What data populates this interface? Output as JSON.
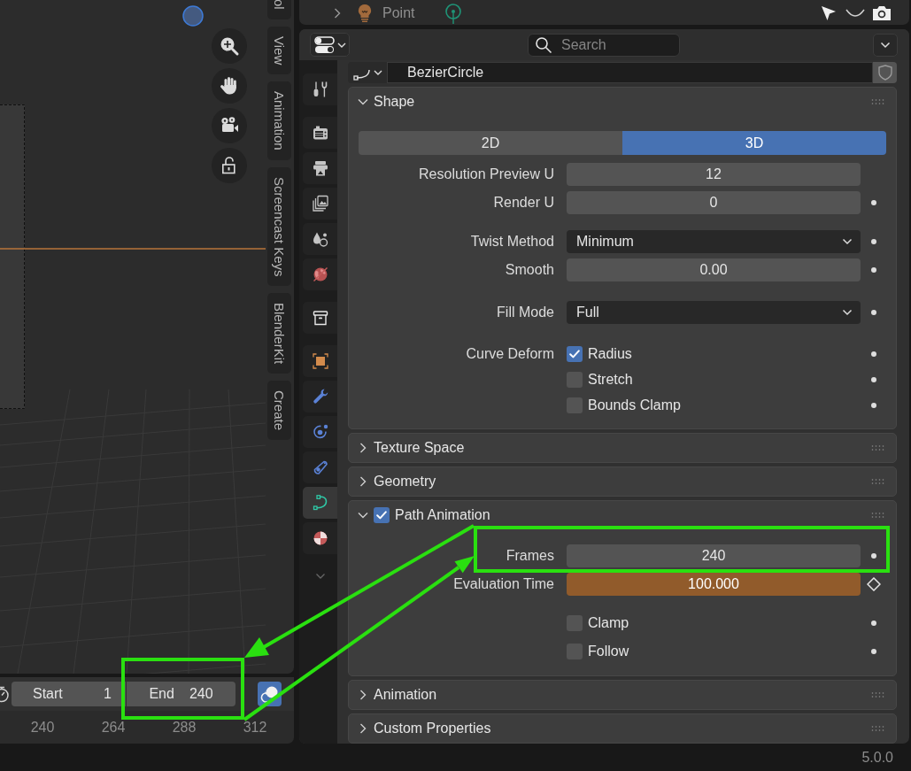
{
  "viewport": {
    "sidebar_tabs": [
      {
        "label": "ol"
      },
      {
        "label": "View"
      },
      {
        "label": "Animation"
      },
      {
        "label": "Screencast Keys"
      },
      {
        "label": "BlenderKit"
      },
      {
        "label": "Create"
      }
    ]
  },
  "timeline": {
    "start": {
      "label": "Start",
      "value": "1"
    },
    "end": {
      "label": "End",
      "value": "240"
    },
    "toggle": {
      "on": true
    },
    "frame_numbers": [
      "240",
      "264",
      "288",
      "312"
    ]
  },
  "outliner": {
    "row": {
      "label": "Point",
      "expanded": false
    }
  },
  "properties": {
    "search": {
      "placeholder": "Search"
    },
    "tab_groups": [
      [
        {
          "kind": "tool",
          "selected": false
        }
      ],
      [
        {
          "kind": "render",
          "selected": false
        },
        {
          "kind": "output",
          "selected": false
        },
        {
          "kind": "view_layer",
          "selected": false
        },
        {
          "kind": "scene",
          "selected": false
        },
        {
          "kind": "world",
          "selected": false
        }
      ],
      [
        {
          "kind": "collection",
          "selected": false
        }
      ],
      [
        {
          "kind": "object",
          "selected": false
        },
        {
          "kind": "modifiers",
          "selected": false
        },
        {
          "kind": "particles",
          "selected": false
        },
        {
          "kind": "physics",
          "selected": false
        },
        {
          "kind": "data",
          "selected": true
        },
        {
          "kind": "material",
          "selected": false
        }
      ]
    ],
    "datablock": {
      "value": "BezierCircle"
    },
    "panels": [
      {
        "title": "Shape",
        "expanded": true,
        "groups": [
          [
            {
              "kind": "segmented",
              "options": [
                {
                  "label": "2D",
                  "selected": false
                },
                {
                  "label": "3D",
                  "selected": true
                }
              ]
            },
            {
              "kind": "number",
              "label": "Resolution Preview U",
              "value": "12",
              "animated": false
            },
            {
              "kind": "number",
              "label": "Render U",
              "value": "0",
              "animated": false,
              "keyframed": false
            }
          ],
          [
            {
              "kind": "dropdown",
              "label": "Twist Method",
              "value": "Minimum",
              "keyframed": false
            },
            {
              "kind": "number",
              "label": "Smooth",
              "value": "0.00",
              "animated": false,
              "keyframed": false
            }
          ],
          [
            {
              "kind": "dropdown",
              "label": "Fill Mode",
              "value": "Full",
              "keyframed": false
            }
          ],
          [
            {
              "kind": "checkbox_column",
              "label": "Curve Deform",
              "items": [
                {
                  "text": "Radius",
                  "checked": true,
                  "keyframed": false
                },
                {
                  "text": "Stretch",
                  "checked": false,
                  "keyframed": false
                },
                {
                  "text": "Bounds Clamp",
                  "checked": false,
                  "keyframed": false
                }
              ]
            }
          ]
        ]
      },
      {
        "title": "Texture Space",
        "expanded": false
      },
      {
        "title": "Geometry",
        "expanded": false
      },
      {
        "title": "Path Animation",
        "expanded": true,
        "checked": true,
        "groups": [
          [
            {
              "kind": "number",
              "label": "Frames",
              "value": "240",
              "animated": false,
              "keyframed": false
            },
            {
              "kind": "number",
              "label": "Evaluation Time",
              "value": "100.000",
              "animated": true,
              "keyframed": true
            }
          ],
          [
            {
              "kind": "checkbox",
              "text": "Clamp",
              "checked": false,
              "keyframed": false
            },
            {
              "kind": "checkbox",
              "text": "Follow",
              "checked": false,
              "keyframed": false
            }
          ]
        ]
      },
      {
        "title": "Animation",
        "expanded": false
      },
      {
        "title": "Custom Properties",
        "expanded": false
      }
    ]
  },
  "status_bar": {
    "version": "5.0.0"
  }
}
